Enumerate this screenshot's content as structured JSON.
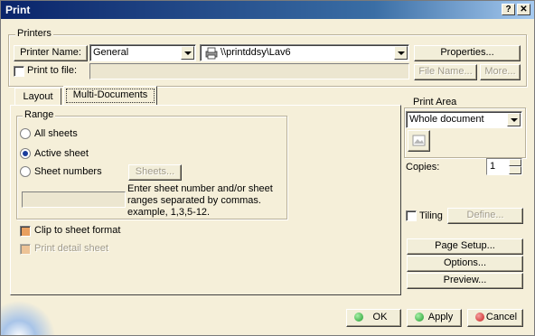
{
  "window": {
    "title": "Print",
    "help_label": "?",
    "close_label": "✕"
  },
  "printers": {
    "group_label": "Printers",
    "printer_name_button": "Printer Name:",
    "printer_name_value": "General",
    "printer_path": "\\\\printddsy\\Lav6",
    "properties_button": "Properties...",
    "print_to_file_label": "Print to file:",
    "file_name_button": "File Name...",
    "more_button": "More..."
  },
  "tabs": [
    {
      "label": "Layout"
    },
    {
      "label": "Multi-Documents"
    }
  ],
  "range": {
    "group_label": "Range",
    "all_sheets": "All sheets",
    "active_sheet": "Active sheet",
    "sheet_numbers": "Sheet numbers",
    "sheets_button": "Sheets...",
    "hint": "Enter sheet number and/or sheet ranges separated by commas. example, 1,3,5-12.",
    "clip_label": "Clip to sheet format",
    "detail_label": "Print detail sheet"
  },
  "print_area": {
    "group_label": "Print Area",
    "value": "Whole document"
  },
  "copies": {
    "label": "Copies:",
    "value": "1"
  },
  "tiling": {
    "label": "Tiling",
    "define_button": "Define..."
  },
  "side_buttons": {
    "page_setup": "Page Setup...",
    "options": "Options...",
    "preview": "Preview..."
  },
  "footer": {
    "ok": "OK",
    "apply": "Apply",
    "cancel": "Cancel"
  },
  "colors": {
    "ok_dot": "#1c9c2c",
    "apply_dot": "#1c9c2c",
    "cancel_dot": "#c81c1c",
    "title_bar": "#0a246a"
  }
}
